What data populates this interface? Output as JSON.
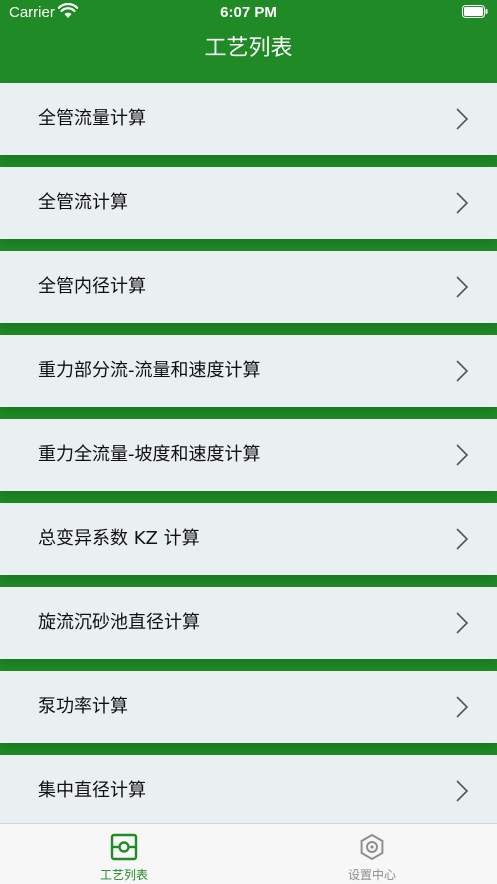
{
  "status_bar": {
    "carrier": "Carrier",
    "time": "6:07 PM"
  },
  "navbar": {
    "title": "工艺列表"
  },
  "list": {
    "items": [
      {
        "label": "全管流量计算"
      },
      {
        "label": "全管流计算"
      },
      {
        "label": "全管内径计算"
      },
      {
        "label": "重力部分流-流量和速度计算"
      },
      {
        "label": "重力全流量-坡度和速度计算"
      },
      {
        "label": "总变异系数 KZ 计算"
      },
      {
        "label": "旋流沉砂池直径计算"
      },
      {
        "label": "泵功率计算"
      },
      {
        "label": "集中直径计算"
      }
    ]
  },
  "tab_bar": {
    "tabs": [
      {
        "label": "工艺列表",
        "icon": "process-list-icon",
        "active": true
      },
      {
        "label": "设置中心",
        "icon": "settings-icon",
        "active": false
      }
    ]
  },
  "colors": {
    "brand_green": "#1f8a26",
    "row_background": "#eaf0f1",
    "active_tab": "#1f8a26",
    "inactive_tab": "#8e8e8e"
  }
}
